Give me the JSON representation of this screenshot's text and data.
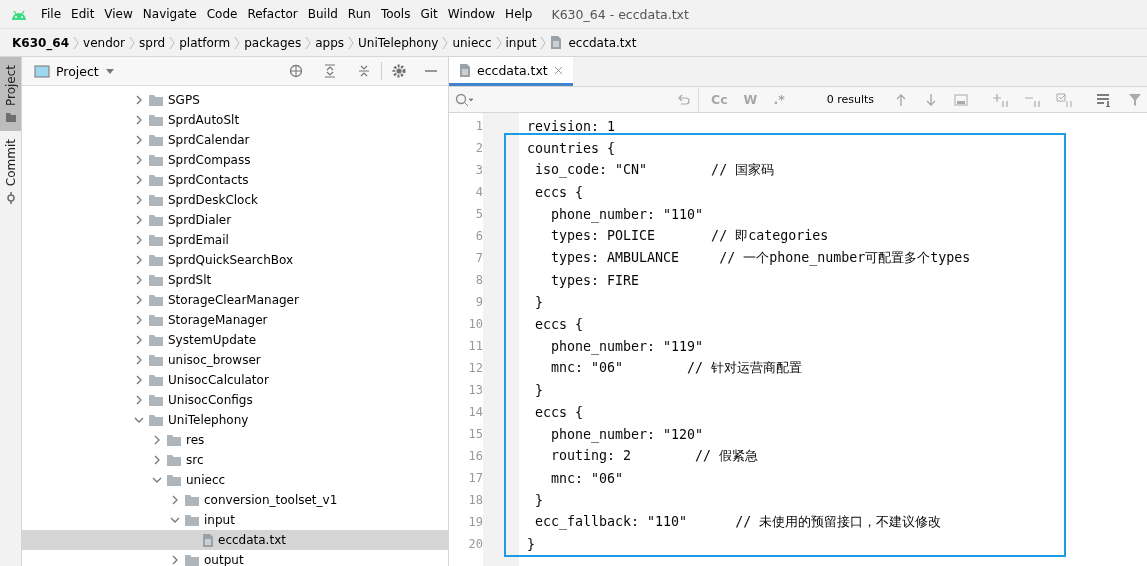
{
  "menu_bar": {
    "items": [
      "File",
      "Edit",
      "View",
      "Navigate",
      "Code",
      "Refactor",
      "Build",
      "Run",
      "Tools",
      "Git",
      "Window",
      "Help"
    ],
    "title": "K630_64 - eccdata.txt"
  },
  "breadcrumb": [
    {
      "label": "K630_64",
      "kind": "project"
    },
    {
      "label": "vendor",
      "kind": "folder"
    },
    {
      "label": "sprd",
      "kind": "folder"
    },
    {
      "label": "platform",
      "kind": "folder"
    },
    {
      "label": "packages",
      "kind": "folder"
    },
    {
      "label": "apps",
      "kind": "folder"
    },
    {
      "label": "UniTelephony",
      "kind": "folder"
    },
    {
      "label": "uniecc",
      "kind": "folder"
    },
    {
      "label": "input",
      "kind": "folder"
    },
    {
      "label": "eccdata.txt",
      "kind": "file"
    }
  ],
  "side_stripe": [
    {
      "label": "Project",
      "selected": true
    },
    {
      "label": "Commit",
      "selected": false
    }
  ],
  "project_panel": {
    "title": "Project",
    "tree": [
      {
        "label": "SGPS",
        "kind": "folder",
        "expanded": false,
        "selected": false
      },
      {
        "label": "SprdAutoSlt",
        "kind": "folder",
        "expanded": false,
        "selected": false
      },
      {
        "label": "SprdCalendar",
        "kind": "folder",
        "expanded": false,
        "selected": false
      },
      {
        "label": "SprdCompass",
        "kind": "folder",
        "expanded": false,
        "selected": false
      },
      {
        "label": "SprdContacts",
        "kind": "folder",
        "expanded": false,
        "selected": false
      },
      {
        "label": "SprdDeskClock",
        "kind": "folder",
        "expanded": false,
        "selected": false
      },
      {
        "label": "SprdDialer",
        "kind": "folder",
        "expanded": false,
        "selected": false
      },
      {
        "label": "SprdEmail",
        "kind": "folder",
        "expanded": false,
        "selected": false
      },
      {
        "label": "SprdQuickSearchBox",
        "kind": "folder",
        "expanded": false,
        "selected": false
      },
      {
        "label": "SprdSlt",
        "kind": "folder",
        "expanded": false,
        "selected": false
      },
      {
        "label": "StorageClearManager",
        "kind": "folder",
        "expanded": false,
        "selected": false
      },
      {
        "label": "StorageManager",
        "kind": "folder",
        "expanded": false,
        "selected": false
      },
      {
        "label": "SystemUpdate",
        "kind": "folder",
        "expanded": false,
        "selected": false
      },
      {
        "label": "unisoc_browser",
        "kind": "folder",
        "expanded": false,
        "selected": false
      },
      {
        "label": "UnisocCalculator",
        "kind": "folder",
        "expanded": false,
        "selected": false
      },
      {
        "label": "UnisocConfigs",
        "kind": "folder",
        "expanded": false,
        "selected": false
      },
      {
        "label": "UniTelephony",
        "kind": "folder",
        "expanded": true,
        "selected": false,
        "children": [
          {
            "label": "res",
            "kind": "folder",
            "expanded": false,
            "selected": false
          },
          {
            "label": "src",
            "kind": "folder",
            "expanded": false,
            "selected": false
          },
          {
            "label": "uniecc",
            "kind": "folder",
            "expanded": true,
            "selected": false,
            "children": [
              {
                "label": "conversion_toolset_v1",
                "kind": "folder",
                "expanded": false,
                "selected": false
              },
              {
                "label": "input",
                "kind": "folder",
                "expanded": true,
                "selected": false,
                "children": [
                  {
                    "label": "eccdata.txt",
                    "kind": "file",
                    "selected": true
                  }
                ]
              },
              {
                "label": "output",
                "kind": "folder",
                "expanded": false,
                "selected": false
              }
            ]
          }
        ]
      }
    ]
  },
  "editor": {
    "tabs": [
      {
        "label": "eccdata.txt",
        "selected": true
      }
    ],
    "find_bar": {
      "options": [
        "Cc",
        "W",
        ".*"
      ],
      "results": "0 results"
    },
    "lines": [
      {
        "number": "1",
        "text": "revision: 1"
      },
      {
        "number": "2",
        "text": "countries {"
      },
      {
        "number": "3",
        "text": " iso_code: \"CN\"        // 国家码"
      },
      {
        "number": "4",
        "text": " eccs {"
      },
      {
        "number": "5",
        "text": "   phone_number: \"110\""
      },
      {
        "number": "6",
        "text": "   types: POLICE       // 即categories"
      },
      {
        "number": "7",
        "text": "   types: AMBULANCE     // 一个phone_number可配置多个types"
      },
      {
        "number": "8",
        "text": "   types: FIRE"
      },
      {
        "number": "9",
        "text": " }"
      },
      {
        "number": "10",
        "text": " eccs {"
      },
      {
        "number": "11",
        "text": "   phone_number: \"119\""
      },
      {
        "number": "12",
        "text": "   mnc: \"06\"        // 针对运营商配置"
      },
      {
        "number": "13",
        "text": " }"
      },
      {
        "number": "14",
        "text": " eccs {"
      },
      {
        "number": "15",
        "text": "   phone_number: \"120\""
      },
      {
        "number": "16",
        "text": "   routing: 2        // 假紧急"
      },
      {
        "number": "17",
        "text": "   mnc: \"06\""
      },
      {
        "number": "18",
        "text": " }"
      },
      {
        "number": "19",
        "text": " ecc_fallback: \"110\"      // 未使用的预留接口，不建议修改"
      },
      {
        "number": "20",
        "text": "}"
      }
    ]
  }
}
